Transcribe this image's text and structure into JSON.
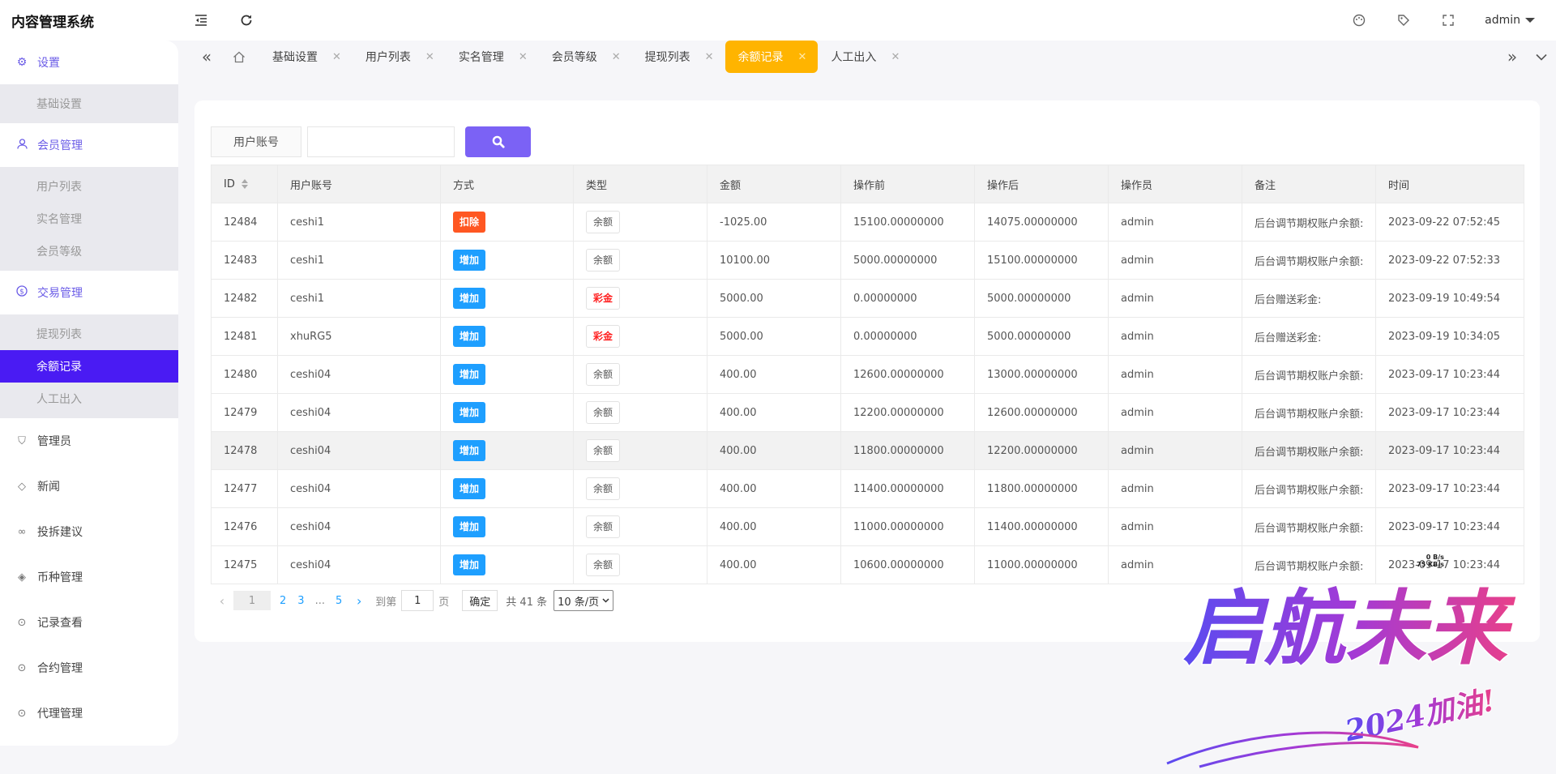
{
  "app": {
    "title": "内容管理系统",
    "user": "admin"
  },
  "sidebar": {
    "groups": [
      {
        "label": "设置",
        "items": [
          "基础设置"
        ]
      },
      {
        "label": "会员管理",
        "items": [
          "用户列表",
          "实名管理",
          "会员等级"
        ]
      },
      {
        "label": "交易管理",
        "items": [
          "提现列表",
          "余额记录",
          "人工出入"
        ]
      }
    ],
    "plain": [
      "管理员",
      "新闻",
      "投拆建议",
      "币种管理",
      "记录查看",
      "合约管理",
      "代理管理"
    ]
  },
  "tabs": [
    "基础设置",
    "用户列表",
    "实名管理",
    "会员等级",
    "提现列表",
    "余额记录",
    "人工出入"
  ],
  "search": {
    "label": "用户账号",
    "value": ""
  },
  "table": {
    "headers": [
      "ID",
      "用户账号",
      "方式",
      "类型",
      "金额",
      "操作前",
      "操作后",
      "操作员",
      "备注",
      "时间"
    ],
    "rows": [
      [
        "12484",
        "ceshi1",
        "扣除",
        "余额",
        "-1025.00",
        "15100.00000000",
        "14075.00000000",
        "admin",
        "后台调节期权账户余额:",
        "2023-09-22 07:52:45"
      ],
      [
        "12483",
        "ceshi1",
        "增加",
        "余额",
        "10100.00",
        "5000.00000000",
        "15100.00000000",
        "admin",
        "后台调节期权账户余额:",
        "2023-09-22 07:52:33"
      ],
      [
        "12482",
        "ceshi1",
        "增加",
        "彩金",
        "5000.00",
        "0.00000000",
        "5000.00000000",
        "admin",
        "后台赠送彩金:",
        "2023-09-19 10:49:54"
      ],
      [
        "12481",
        "xhuRG5",
        "增加",
        "彩金",
        "5000.00",
        "0.00000000",
        "5000.00000000",
        "admin",
        "后台赠送彩金:",
        "2023-09-19 10:34:05"
      ],
      [
        "12480",
        "ceshi04",
        "增加",
        "余额",
        "400.00",
        "12600.00000000",
        "13000.00000000",
        "admin",
        "后台调节期权账户余额:",
        "2023-09-17 10:23:44"
      ],
      [
        "12479",
        "ceshi04",
        "增加",
        "余额",
        "400.00",
        "12200.00000000",
        "12600.00000000",
        "admin",
        "后台调节期权账户余额:",
        "2023-09-17 10:23:44"
      ],
      [
        "12478",
        "ceshi04",
        "增加",
        "余额",
        "400.00",
        "11800.00000000",
        "12200.00000000",
        "admin",
        "后台调节期权账户余额:",
        "2023-09-17 10:23:44"
      ],
      [
        "12477",
        "ceshi04",
        "增加",
        "余额",
        "400.00",
        "11400.00000000",
        "11800.00000000",
        "admin",
        "后台调节期权账户余额:",
        "2023-09-17 10:23:44"
      ],
      [
        "12476",
        "ceshi04",
        "增加",
        "余额",
        "400.00",
        "11000.00000000",
        "11400.00000000",
        "admin",
        "后台调节期权账户余额:",
        "2023-09-17 10:23:44"
      ],
      [
        "12475",
        "ceshi04",
        "增加",
        "余额",
        "400.00",
        "10600.00000000",
        "11000.00000000",
        "admin",
        "后台调节期权账户余额:",
        "2023-09-17 10:23:44"
      ]
    ]
  },
  "pager": {
    "pages": [
      "1",
      "2",
      "3",
      "...",
      "5"
    ],
    "goto_label": "到第",
    "goto_value": "1",
    "page_unit": "页",
    "confirm": "确定",
    "total": "共 41 条",
    "page_size": "10 条/页"
  },
  "decoration": {
    "slogan": "启航未来",
    "sub": "2024加油!",
    "net_down": "0 B/s",
    "net_up": "75 KB/s"
  },
  "colors": {
    "accent": "#6b5ce7",
    "selected_menu": "#4a1bf3",
    "active_tab": "#ffb400",
    "add": "#1e9fff",
    "deduct": "#ff5722",
    "search_btn": "#7b62f5"
  },
  "icons": {
    "collapse": "indent-icon",
    "refresh": "refresh-icon",
    "theme": "palette-icon",
    "tag": "tag-icon",
    "fullscreen": "fullscreen-icon",
    "home": "home-icon",
    "search": "magnifier-icon",
    "sidebar": [
      "gear-icon",
      "user-icon",
      "dollar-icon",
      "shield-icon",
      "tag-icon",
      "link-icon",
      "diamond-icon",
      "record-icon",
      "contract-icon",
      "agent-icon"
    ]
  }
}
